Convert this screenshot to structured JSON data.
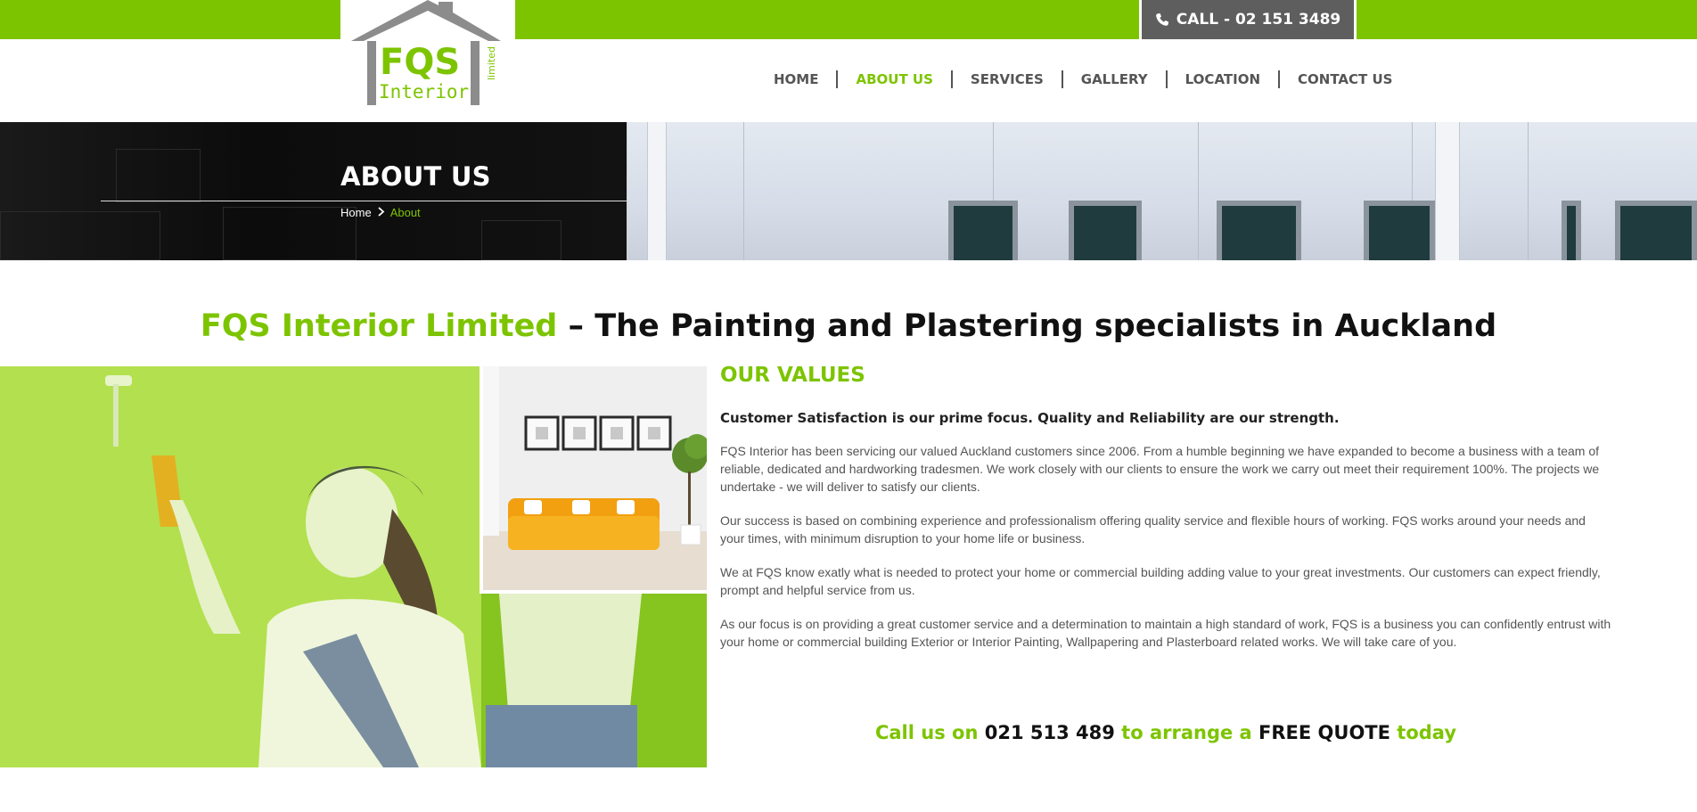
{
  "header": {
    "call_label": "CALL - 02 151 3489",
    "logo": {
      "text_main": "FQS",
      "text_sub": "Interior",
      "text_side": "limited"
    }
  },
  "nav": {
    "items": [
      {
        "label": "HOME"
      },
      {
        "label": "ABOUT US"
      },
      {
        "label": "SERVICES"
      },
      {
        "label": "GALLERY"
      },
      {
        "label": "LOCATION"
      },
      {
        "label": "CONTACT US"
      }
    ],
    "active": "ABOUT US"
  },
  "banner": {
    "title": "ABOUT US",
    "breadcrumb": {
      "home": "Home",
      "current": "About"
    }
  },
  "headline": {
    "brand": "FQS Interior Limited",
    "rest": " – The Painting and Plastering specialists in Auckland"
  },
  "values": {
    "heading": "OUR VALUES",
    "lead": "Customer Satisfaction is our prime focus. Quality and Reliability are our strength.",
    "paragraphs": [
      "FQS Interior has been servicing our valued Auckland customers since 2006. From a humble beginning we have expanded to become a business with a team of reliable, dedicated and hardworking tradesmen. We work closely with our clients to ensure the work we carry out meet their requirement 100%. The projects we undertake - we will deliver to satisfy our clients.",
      "Our success is based on combining experience and professionalism offering quality service and flexible hours of working. FQS works around your needs and your times, with minimum disruption to your home life or business.",
      "We at FQS know exatly what is needed to protect your home or commercial building adding value to your great investments. Our customers can expect friendly, prompt and helpful service from us.",
      "As our focus is on providing a great customer service and a determination to maintain a high standard of work, FQS is a business you can confidently entrust with your home or commercial building Exterior or Interior Painting, Wallpapering and Plasterboard related works. We will take care of you."
    ]
  },
  "cta": {
    "part1": "Call us on ",
    "phone": "021 513 489",
    "part2": " to arrange a ",
    "offer": "FREE QUOTE",
    "part3": " today"
  },
  "colors": {
    "accent": "#7dc400",
    "call_box": "#5e5e5e",
    "banner_dark": "#0d0d0d"
  },
  "icons": {
    "phone": "phone-icon",
    "breadcrumb_separator": "chevron-right-icon"
  }
}
